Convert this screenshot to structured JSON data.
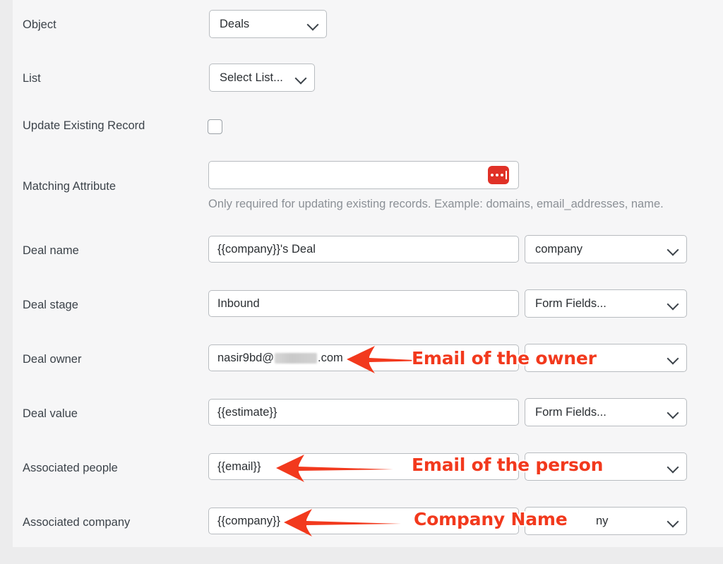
{
  "page": {
    "background": "#ececed",
    "panel_background": "#f6f6f7",
    "accent_red": "#e03127",
    "annotation_red": "#f2391d"
  },
  "fields": {
    "object": {
      "label": "Object",
      "select_value": "Deals"
    },
    "list": {
      "label": "List",
      "select_value": "Select List..."
    },
    "update_existing_record": {
      "label": "Update Existing Record",
      "checked": false
    },
    "matching_attribute": {
      "label": "Matching Attribute",
      "value": "",
      "button_icon": "ellipsis-icon",
      "helper_text": "Only required for updating existing records. Example: domains, email_addresses, name."
    },
    "deal_name": {
      "label": "Deal name",
      "value": "{{company}}'s Deal",
      "select_value": "company"
    },
    "deal_stage": {
      "label": "Deal stage",
      "value": "Inbound",
      "select_value": "Form Fields..."
    },
    "deal_owner": {
      "label": "Deal owner",
      "value_prefix": "nasir9bd@",
      "value_suffix": ".com",
      "redacted": true,
      "select_value": ""
    },
    "deal_value": {
      "label": "Deal value",
      "value": "{{estimate}}",
      "select_value": "Form Fields..."
    },
    "associated_people": {
      "label": "Associated people",
      "value": "{{email}}",
      "select_value": ""
    },
    "associated_company": {
      "label": "Associated company",
      "value": "{{company}}",
      "select_value": "ny"
    }
  },
  "annotations": [
    {
      "text": "Email of the owner",
      "arrow": "left-arrow-icon"
    },
    {
      "text": "Email of the person",
      "arrow": "left-arrow-icon"
    },
    {
      "text": "Company Name",
      "arrow": "left-arrow-icon"
    }
  ]
}
